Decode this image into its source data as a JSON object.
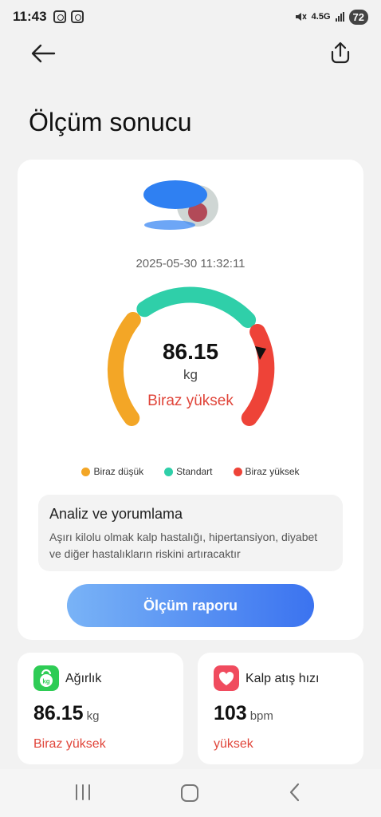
{
  "status_bar": {
    "time": "11:43",
    "network": "4.5G",
    "battery": "72",
    "icons": [
      "screenshot-icon",
      "instagram-icon",
      "mute-icon",
      "signal-icon",
      "battery-icon"
    ]
  },
  "header": {
    "title": "Ölçüm sonucu",
    "back_icon": "arrow-left-icon",
    "share_icon": "share-icon"
  },
  "result": {
    "datetime": "2025-05-30 11:32:11",
    "value": "86.15",
    "unit": "kg",
    "status": "Biraz yüksek",
    "gauge_colors": {
      "low": "#f3a626",
      "standard": "#2fcfa9",
      "high": "#ee4338"
    }
  },
  "legend": [
    {
      "label": "Biraz düşük",
      "color": "#f3a626"
    },
    {
      "label": "Standart",
      "color": "#2fcfa9"
    },
    {
      "label": "Biraz yüksek",
      "color": "#ee4338"
    }
  ],
  "analysis": {
    "title": "Analiz ve yorumlama",
    "text": "Aşırı kilolu olmak kalp hastalığı, hipertansiyon, diyabet ve diğer hastalıkların riskini artıracaktır"
  },
  "report_button": "Ölçüm raporu",
  "metrics": [
    {
      "title": "Ağırlık",
      "value": "86.15",
      "unit": "kg",
      "status": "Biraz yüksek",
      "icon": "kettlebell-icon",
      "icon_label": "kg",
      "color": "#2ecc55"
    },
    {
      "title": "Kalp atış hızı",
      "value": "103",
      "unit": "bpm",
      "status": "yüksek",
      "icon": "heart-icon",
      "color": "#f04b5e"
    }
  ]
}
